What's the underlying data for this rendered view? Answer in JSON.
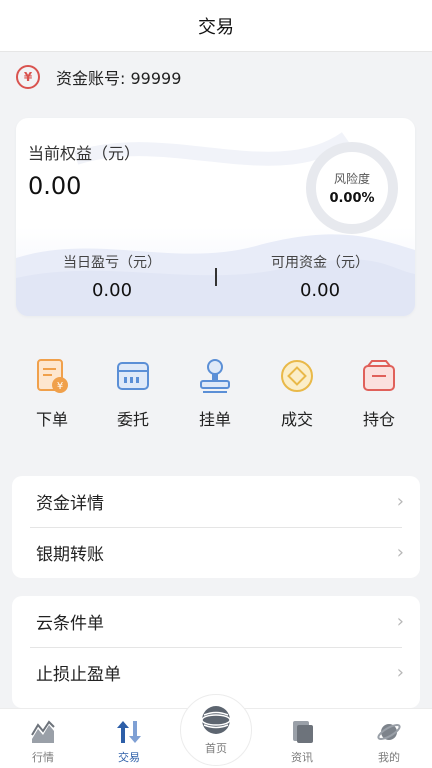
{
  "header": {
    "title": "交易"
  },
  "account": {
    "label": "资金账号: 99999",
    "icon": "yen-circle-icon"
  },
  "summary": {
    "equity_label": "当前权益（元）",
    "equity_value": "0.00",
    "risk_label": "风险度",
    "risk_value": "0.00%",
    "daily_pl_label": "当日盈亏（元）",
    "daily_pl_value": "0.00",
    "available_label": "可用资金（元）",
    "available_value": "0.00"
  },
  "quick_actions": [
    {
      "label": "下单",
      "icon": "order-icon"
    },
    {
      "label": "委托",
      "icon": "entrust-icon"
    },
    {
      "label": "挂单",
      "icon": "stamp-icon"
    },
    {
      "label": "成交",
      "icon": "coin-icon"
    },
    {
      "label": "持仓",
      "icon": "position-icon"
    }
  ],
  "menu_group_1": [
    {
      "label": "资金详情"
    },
    {
      "label": "银期转账"
    }
  ],
  "menu_group_2": [
    {
      "label": "云条件单"
    },
    {
      "label": "止损止盈单"
    }
  ],
  "tabbar": {
    "items": [
      {
        "label": "行情",
        "icon": "market-icon"
      },
      {
        "label": "交易",
        "icon": "trade-icon"
      },
      {
        "label": "首页",
        "icon": "globe-icon"
      },
      {
        "label": "资讯",
        "icon": "news-icon"
      },
      {
        "label": "我的",
        "icon": "planet-icon"
      }
    ],
    "active": "交易"
  },
  "colors": {
    "accent": "#2d5fa8",
    "orange": "#f0a04b",
    "blue": "#5b8fd6",
    "gold": "#e9b949",
    "red": "#e0605a",
    "background": "#f2f3f5"
  }
}
